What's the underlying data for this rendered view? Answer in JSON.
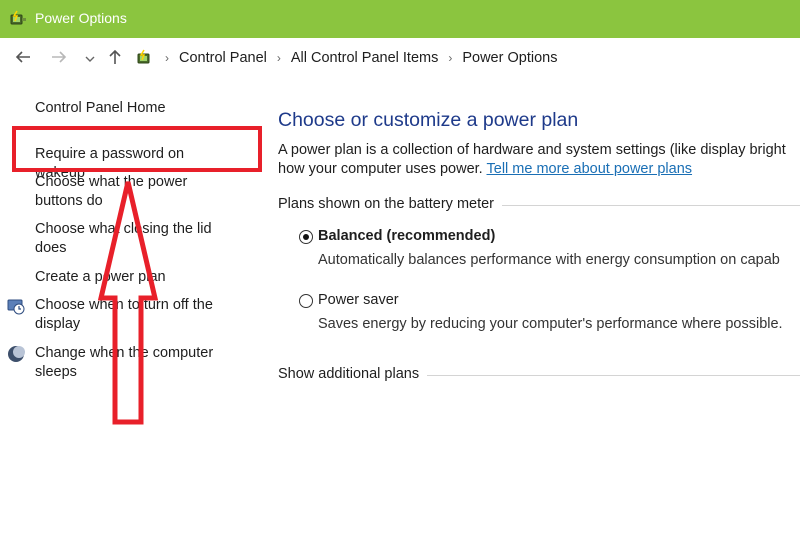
{
  "window": {
    "title": "Power Options",
    "accent": "#8bc53f"
  },
  "nav": {
    "back_icon": "arrow-left-icon",
    "forward_icon": "arrow-right-icon",
    "recent_icon": "chevron-down-icon",
    "up_icon": "arrow-up-icon"
  },
  "breadcrumb": [
    "Control Panel",
    "All Control Panel Items",
    "Power Options"
  ],
  "sidebar": {
    "home": "Control Panel Home",
    "items": [
      "Require a password on wakeup",
      "Choose what the power buttons do",
      "Choose what closing the lid does",
      "Create a power plan",
      "Choose when to turn off the display",
      "Change when the computer sleeps"
    ]
  },
  "main": {
    "title": "Choose or customize a power plan",
    "description_line1": "A power plan is a collection of hardware and system settings (like display bright",
    "description_line2": "how your computer uses power.",
    "learn_more_link": "Tell me more about power plans",
    "group_label": "Plans shown on the battery meter",
    "plans": [
      {
        "name": "Balanced (recommended)",
        "selected": true,
        "description": "Automatically balances performance with energy consumption on capab"
      },
      {
        "name": "Power saver",
        "selected": false,
        "description": "Saves energy by reducing your computer's performance where possible."
      }
    ],
    "show_additional": "Show additional plans"
  },
  "annotation": {
    "color": "#e8202a"
  }
}
